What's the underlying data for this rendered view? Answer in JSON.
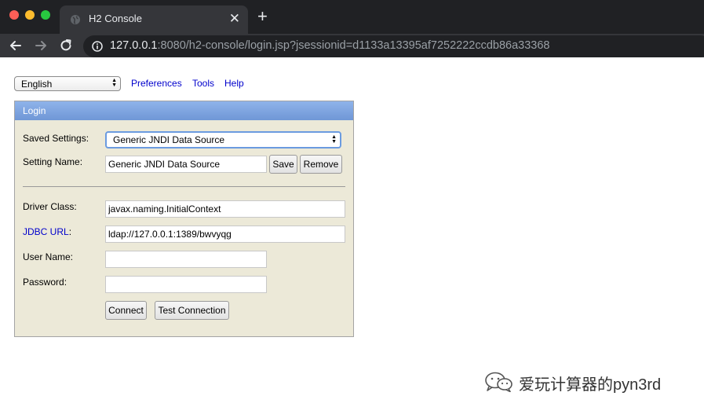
{
  "browser": {
    "tab_title": "H2 Console",
    "close_symbol": "✕",
    "new_tab_symbol": "+",
    "url_host": "127.0.0.1",
    "url_rest": ":8080/h2-console/login.jsp?jsessionid=d1133a13395af7252222ccdb86a33368"
  },
  "topbar": {
    "language": "English",
    "links": [
      "Preferences",
      "Tools",
      "Help"
    ]
  },
  "login": {
    "header": "Login",
    "saved_settings_label": "Saved Settings:",
    "saved_settings_value": "Generic JNDI Data Source",
    "setting_name_label": "Setting Name:",
    "setting_name_value": "Generic JNDI Data Source",
    "save_label": "Save",
    "remove_label": "Remove",
    "driver_class_label": "Driver Class:",
    "driver_class_value": "javax.naming.InitialContext",
    "jdbc_url_label": "JDBC URL",
    "jdbc_url_suffix": ":",
    "jdbc_url_value": "ldap://127.0.0.1:1389/bwvyqg",
    "user_name_label": "User Name:",
    "user_name_value": "",
    "password_label": "Password:",
    "password_value": "",
    "connect_label": "Connect",
    "test_connection_label": "Test Connection"
  },
  "watermark": {
    "text": "爱玩计算器的pyn3rd"
  },
  "colors": {
    "header_blue": "#7aa1df",
    "panel_bg": "#ece9d8",
    "link_blue": "#0000cc"
  }
}
